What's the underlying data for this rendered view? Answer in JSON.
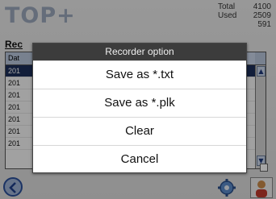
{
  "app": {
    "brand": "TOP+",
    "stats": [
      {
        "label": "Total",
        "value": "4100"
      },
      {
        "label": "Used",
        "value": "2509"
      },
      {
        "label": "",
        "value": "591"
      }
    ],
    "section_label": "Rec",
    "table": {
      "header": "Dat",
      "rows": [
        "201",
        "201",
        "201",
        "201",
        "201",
        "201",
        "201"
      ],
      "selected_row": 0
    }
  },
  "dialog": {
    "title": "Recorder option",
    "options": [
      {
        "label": "Save as *.txt"
      },
      {
        "label": "Save as *.plk"
      },
      {
        "label": "Clear"
      },
      {
        "label": "Cancel"
      }
    ]
  },
  "colors": {
    "title_bar": "#3c3c3c",
    "selected_row": "#1d2f5a",
    "brand": "#9ca8bc"
  }
}
